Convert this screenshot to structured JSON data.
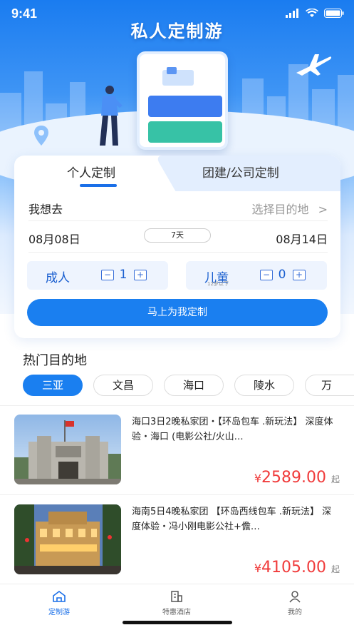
{
  "status_bar": {
    "time": "9:41"
  },
  "hero": {
    "title": "私人定制游"
  },
  "tabs": {
    "personal": "个人定制",
    "company": "团建/公司定制"
  },
  "destination": {
    "label": "我想去",
    "placeholder": "选择目的地",
    "arrow": ">"
  },
  "dates": {
    "start": "08月08日",
    "days": "7天",
    "end": "08月14日"
  },
  "adult": {
    "label": "成人",
    "minus": "−",
    "plus": "+",
    "count": "1"
  },
  "child": {
    "label": "儿童",
    "note": "12岁以下",
    "minus": "−",
    "plus": "+",
    "count": "0"
  },
  "cta": {
    "label": "马上为我定制"
  },
  "hot": {
    "title": "热门目的地",
    "chips": [
      "三亚",
      "文昌",
      "海口",
      "陵水",
      "万"
    ],
    "active_chip": 0
  },
  "items": [
    {
      "title": "海口3日2晚私家团・【环岛包车 .新玩法】 深度体验・海口 (电影公社/火山…",
      "currency": "¥",
      "price": "2589.00",
      "suffix": "起"
    },
    {
      "title": "海南5日4晚私家团 【环岛西线包车 .新玩法】 深度体验・冯小刚电影公社+儋…",
      "currency": "¥",
      "price": "4105.00",
      "suffix": "起"
    }
  ],
  "nav": [
    {
      "label": "定制游",
      "icon": "home-icon",
      "active": true
    },
    {
      "label": "特惠酒店",
      "icon": "hotel-icon",
      "active": false
    },
    {
      "label": "我的",
      "icon": "user-icon",
      "active": false
    }
  ],
  "colors": {
    "brand": "#1a7ff0",
    "price": "#f03b3b"
  }
}
